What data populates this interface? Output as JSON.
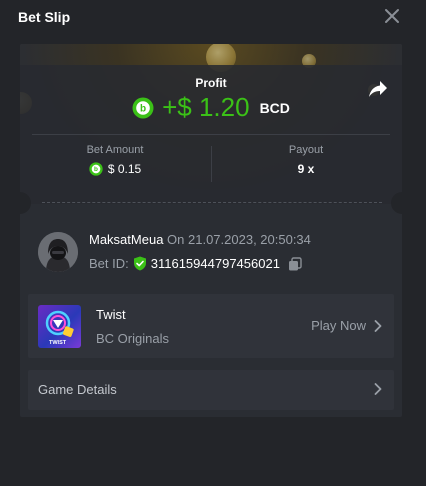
{
  "header": {
    "title": "Bet Slip"
  },
  "profit": {
    "label": "Profit",
    "amount": "+$ 1.20",
    "currency": "BCD"
  },
  "stats": {
    "bet_amount_label": "Bet Amount",
    "bet_amount_value": "$ 0.15",
    "payout_label": "Payout",
    "payout_value": "9 x"
  },
  "player": {
    "name": "MaksatMeua",
    "on_text": "On 21.07.2023, 20:50:34",
    "bet_id_label": "Bet ID:",
    "bet_id": "311615944797456021"
  },
  "game": {
    "thumb_text": "TWIST",
    "name": "Twist",
    "provider": "BC Originals",
    "play_label": "Play Now"
  },
  "details": {
    "label": "Game Details"
  },
  "colors": {
    "accent_green": "#3bc117",
    "background": "#232529",
    "card": "#2a2d33",
    "muted_text": "#9aa0a8"
  }
}
